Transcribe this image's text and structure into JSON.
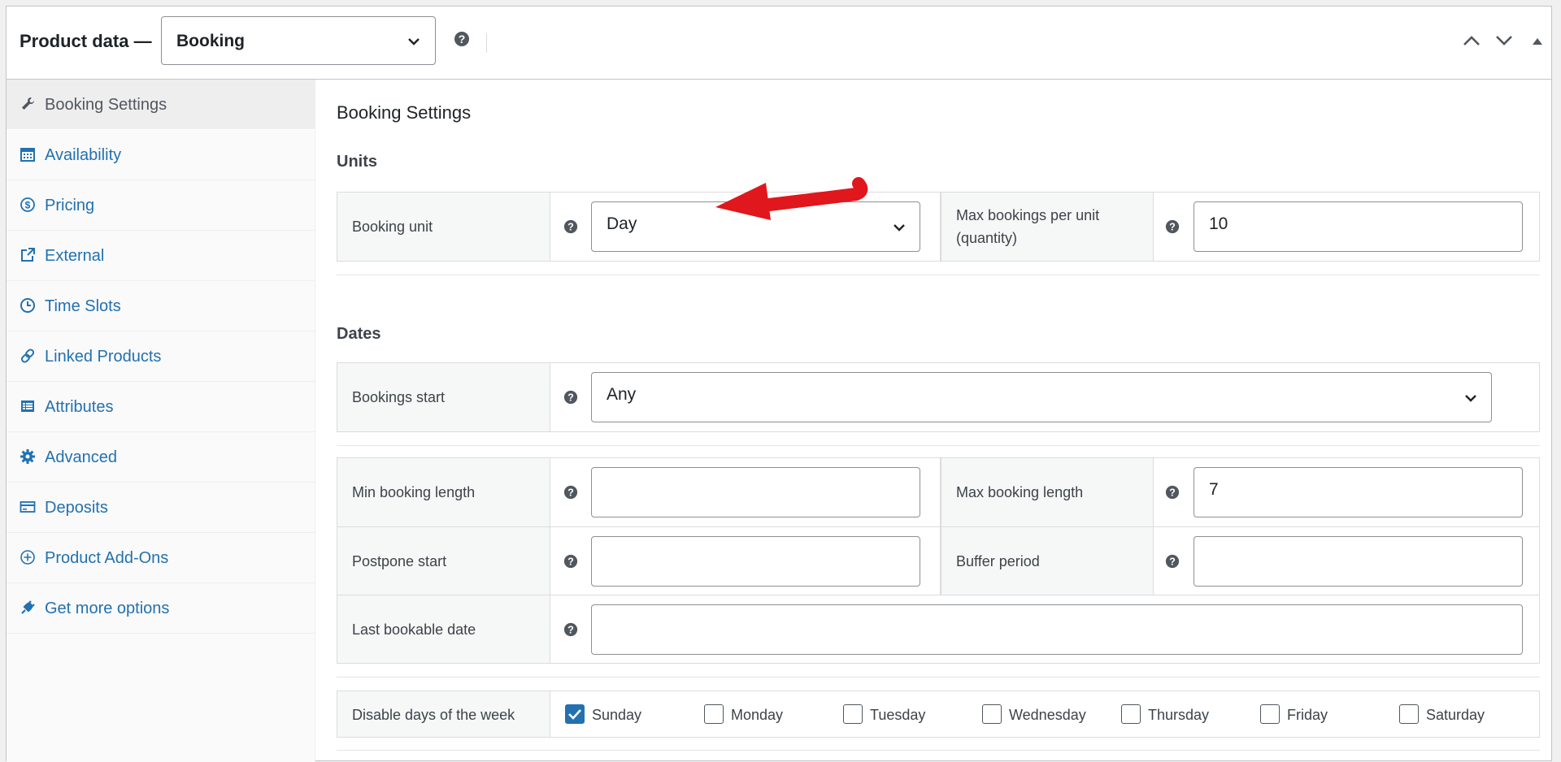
{
  "header": {
    "title": "Product data —",
    "product_type": "Booking"
  },
  "sidebar": {
    "items": [
      {
        "label": "Booking Settings",
        "icon": "wrench-icon",
        "active": true
      },
      {
        "label": "Availability",
        "icon": "calendar-icon"
      },
      {
        "label": "Pricing",
        "icon": "dollar-circle-icon"
      },
      {
        "label": "External",
        "icon": "external-link-icon"
      },
      {
        "label": "Time Slots",
        "icon": "clock-icon"
      },
      {
        "label": "Linked Products",
        "icon": "link-icon"
      },
      {
        "label": "Attributes",
        "icon": "list-table-icon"
      },
      {
        "label": "Advanced",
        "icon": "gear-icon"
      },
      {
        "label": "Deposits",
        "icon": "credit-card-icon"
      },
      {
        "label": "Product Add-Ons",
        "icon": "plus-circle-icon"
      },
      {
        "label": "Get more options",
        "icon": "plugin-icon"
      }
    ]
  },
  "main": {
    "title": "Booking Settings",
    "units": {
      "heading": "Units",
      "booking_unit_label": "Booking unit",
      "booking_unit_value": "Day",
      "max_bookings_label_line1": "Max bookings per unit",
      "max_bookings_label_line2": "(quantity)",
      "max_bookings_value": "10"
    },
    "dates": {
      "heading": "Dates",
      "bookings_start_label": "Bookings start",
      "bookings_start_value": "Any",
      "min_length_label": "Min booking length",
      "min_length_value": "",
      "max_length_label": "Max booking length",
      "max_length_value": "7",
      "postpone_label": "Postpone start",
      "postpone_value": "",
      "buffer_label": "Buffer period",
      "buffer_value": "",
      "last_date_label": "Last bookable date",
      "last_date_value": ""
    },
    "disable_days": {
      "label": "Disable days of the week",
      "days": [
        {
          "name": "Sunday",
          "checked": true
        },
        {
          "name": "Monday",
          "checked": false
        },
        {
          "name": "Tuesday",
          "checked": false
        },
        {
          "name": "Wednesday",
          "checked": false
        },
        {
          "name": "Thursday",
          "checked": false
        },
        {
          "name": "Friday",
          "checked": false
        },
        {
          "name": "Saturday",
          "checked": false
        }
      ]
    }
  },
  "colors": {
    "link": "#2271b1",
    "annotation_arrow": "#e0171d"
  }
}
